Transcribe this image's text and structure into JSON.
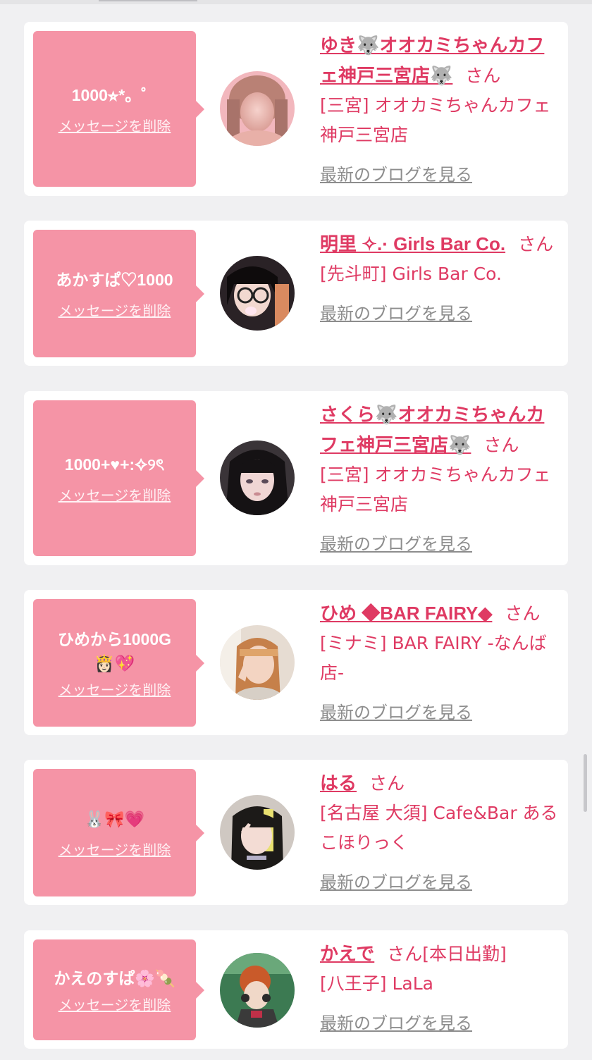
{
  "colors": {
    "accent": "#df3a63",
    "bubble": "#f594a6",
    "page_bg": "#f0f0f2",
    "link_gray": "#8d8d8d"
  },
  "common": {
    "delete_label": "メッセージを削除",
    "blog_label": "最新のブログを見る",
    "san": "さん"
  },
  "messages": [
    {
      "bubble": "1000⭐︎*。゜",
      "name": "ゆき🐺オオカミちゃんカフェ神戸三宮店🐺",
      "suffix": "",
      "shop": "[三宮] オオカミちゃんカフェ神戸三宮店"
    },
    {
      "bubble": "あかすぱ♡1000",
      "name": "明里 ✧.· Girls Bar Co.",
      "suffix": "",
      "shop": "[先斗町] Girls Bar Co."
    },
    {
      "bubble": "1000+♥+:✧୨ৎ",
      "name": "さくら🐺オオカミちゃんカフェ神戸三宮店🐺",
      "suffix": "",
      "shop": "[三宮] オオカミちゃんカフェ神戸三宮店"
    },
    {
      "bubble": "ひめから1000G",
      "bubble_line2": "👸🏻💖",
      "name": "ひめ ◆BAR FAIRY◆",
      "suffix": "",
      "shop": "[ミナミ] BAR FAIRY -なんば店-"
    },
    {
      "bubble": "🐰🎀💗",
      "name": "はる",
      "suffix": "",
      "shop": "[名古屋 大須] Cafe&Bar あるこほりっく"
    },
    {
      "bubble": "かえのすぱ🌸🍡",
      "name": "かえで",
      "suffix": "[本日出勤]",
      "shop": "[八王子] LaLa"
    }
  ]
}
